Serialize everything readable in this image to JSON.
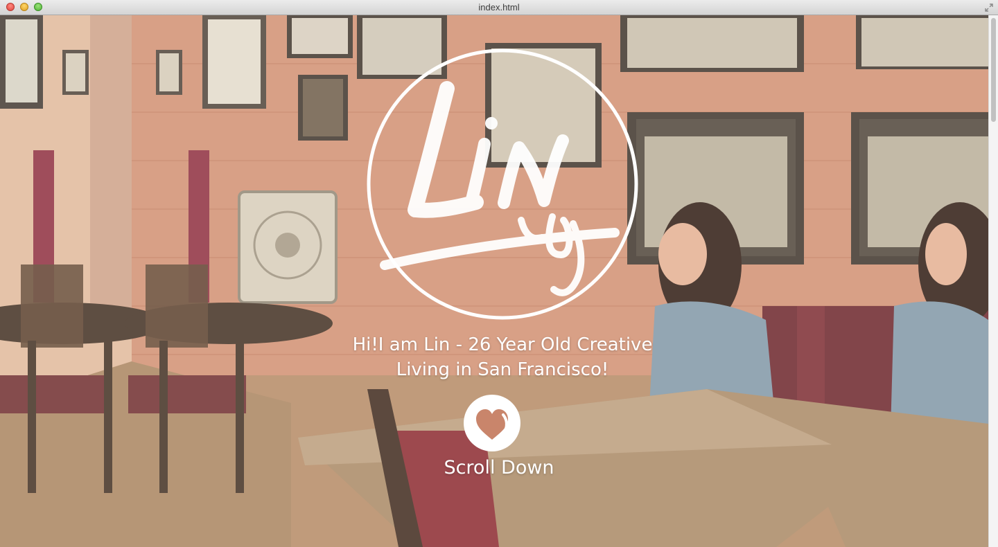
{
  "window": {
    "title": "index.html"
  },
  "hero": {
    "logo": {
      "icon": "lin-signature-logo",
      "text": "Lin"
    },
    "tagline_line1": "Hi!I am Lin - 26 Year Old Creative",
    "tagline_line2": "Living in San Francisco!",
    "scroll_button": {
      "icon": "heart-icon",
      "label": "Scroll Down"
    }
  },
  "colors": {
    "overlay_text": "#ffffff",
    "wall": "#c9856b",
    "accent_red": "#8a2a35"
  }
}
